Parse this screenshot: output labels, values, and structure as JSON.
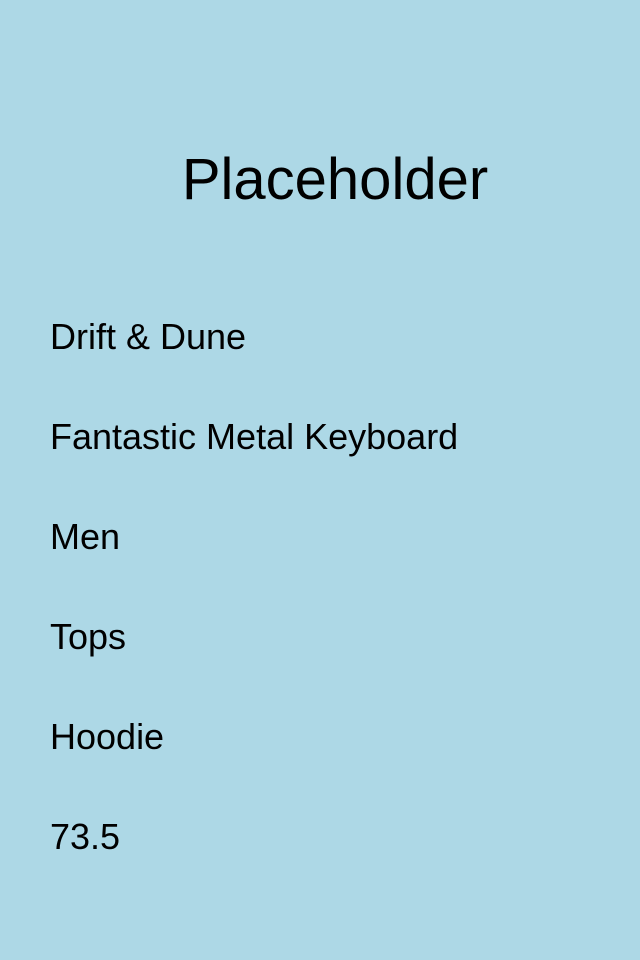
{
  "title": "Placeholder",
  "product": {
    "brand": "Drift & Dune",
    "name": "Fantastic Metal Keyboard",
    "gender": "Men",
    "category": "Tops",
    "subcategory": "Hoodie",
    "price": "73.5"
  },
  "colors": {
    "background": "#add8e6",
    "text": "#000000"
  }
}
